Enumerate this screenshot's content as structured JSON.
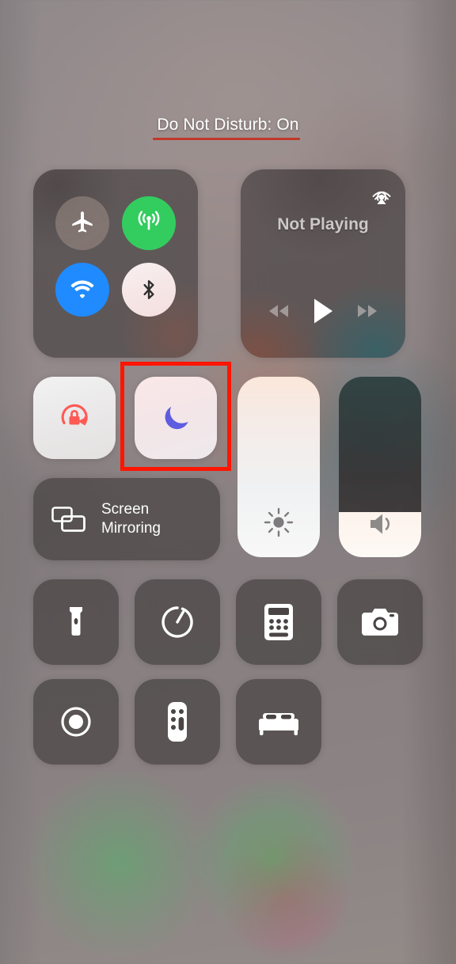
{
  "header": {
    "title": "Do Not Disturb: On",
    "underline_color": "#c0392b"
  },
  "connectivity": {
    "name": "Connectivity",
    "toggles": [
      {
        "id": "airplane",
        "label": "Airplane Mode",
        "icon": "airplane-icon",
        "state": "off",
        "color": "#9b8c84"
      },
      {
        "id": "cellular",
        "label": "Cellular Data",
        "icon": "cellular-icon",
        "state": "on",
        "color": "#33cd5f"
      },
      {
        "id": "wifi",
        "label": "Wi-Fi",
        "icon": "wifi-icon",
        "state": "on",
        "color": "#1f8bff"
      },
      {
        "id": "bluetooth",
        "label": "Bluetooth",
        "icon": "bluetooth-icon",
        "state": "on",
        "color": "#f4e3e4"
      }
    ]
  },
  "media": {
    "status": "Not Playing",
    "airplay_icon": "airplay-icon",
    "controls": [
      {
        "id": "previous",
        "label": "Previous Track",
        "icon": "rewind-icon"
      },
      {
        "id": "play",
        "label": "Play",
        "icon": "play-icon"
      },
      {
        "id": "next",
        "label": "Next Track",
        "icon": "fast-forward-icon"
      }
    ]
  },
  "toggles": {
    "rotation_lock": {
      "label": "Portrait Orientation Lock",
      "icon": "rotation-lock-icon",
      "state": "on",
      "color": "#ff5a55"
    },
    "do_not_disturb": {
      "label": "Do Not Disturb",
      "icon": "moon-icon",
      "state": "on",
      "color": "#5e5ce0"
    }
  },
  "annotation": {
    "target": "do-not-disturb-toggle",
    "color": "#ff1500"
  },
  "screen_mirroring": {
    "label_line1": "Screen",
    "label_line2": "Mirroring",
    "icon": "screen-mirroring-icon"
  },
  "sliders": {
    "brightness": {
      "label": "Brightness",
      "icon": "brightness-icon",
      "value": 100
    },
    "volume": {
      "label": "Volume",
      "icon": "volume-icon",
      "value": 25
    }
  },
  "shortcuts": [
    {
      "id": "flashlight",
      "label": "Flashlight",
      "icon": "flashlight-icon"
    },
    {
      "id": "timer",
      "label": "Timer",
      "icon": "timer-icon"
    },
    {
      "id": "calculator",
      "label": "Calculator",
      "icon": "calculator-icon"
    },
    {
      "id": "camera",
      "label": "Camera",
      "icon": "camera-icon"
    },
    {
      "id": "screen-recording",
      "label": "Screen Recording",
      "icon": "record-icon"
    },
    {
      "id": "apple-tv-remote",
      "label": "Apple TV Remote",
      "icon": "remote-icon"
    },
    {
      "id": "bedtime",
      "label": "Bedtime",
      "icon": "bed-icon"
    }
  ]
}
